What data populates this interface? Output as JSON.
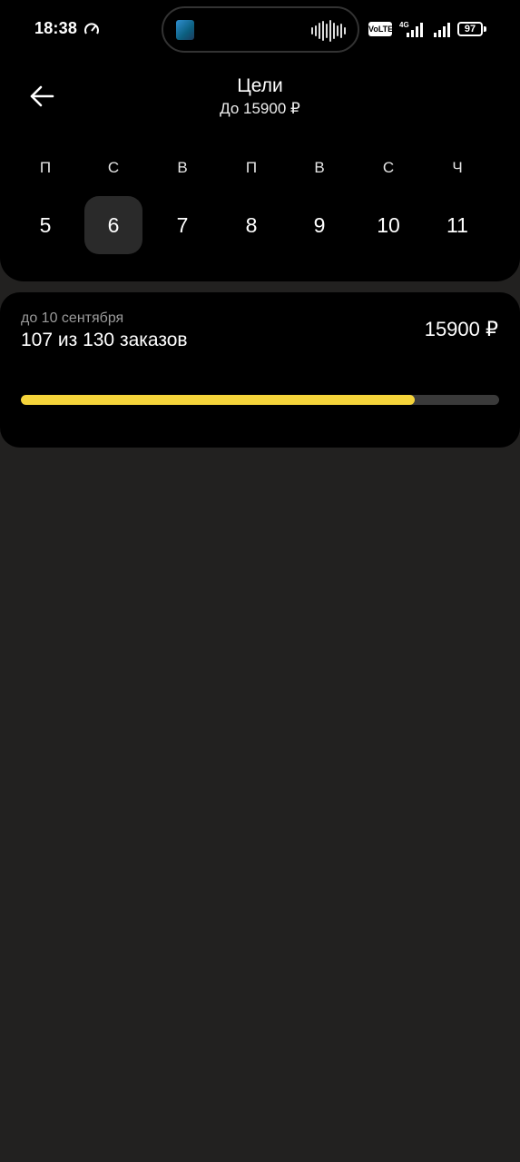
{
  "status_bar": {
    "time": "18:38",
    "volte": "VoLTE",
    "network": "4G",
    "battery": "97"
  },
  "header": {
    "title": "Цели",
    "subtitle": "До 15900 ₽"
  },
  "week": {
    "days": [
      {
        "letter": "П",
        "number": "5",
        "selected": false
      },
      {
        "letter": "С",
        "number": "6",
        "selected": true
      },
      {
        "letter": "В",
        "number": "7",
        "selected": false
      },
      {
        "letter": "П",
        "number": "8",
        "selected": false
      },
      {
        "letter": "В",
        "number": "9",
        "selected": false
      },
      {
        "letter": "С",
        "number": "10",
        "selected": false
      },
      {
        "letter": "Ч",
        "number": "11",
        "selected": false
      }
    ]
  },
  "goal": {
    "deadline": "до 10 сентября",
    "progress_text": "107 из 130 заказов",
    "amount": "15900 ₽",
    "completed": 107,
    "total": 130
  },
  "colors": {
    "accent": "#f5d43a",
    "panel": "#000000",
    "background": "#222120"
  }
}
